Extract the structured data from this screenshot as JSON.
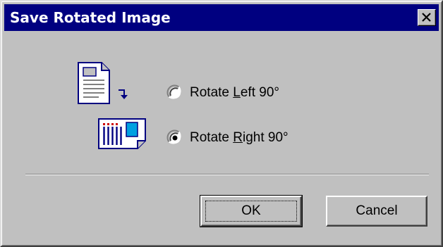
{
  "window": {
    "title": "Save Rotated Image",
    "close_icon": "close-icon"
  },
  "icons": {
    "original": "document-icon",
    "arrow": "rotate-arrow-icon",
    "rotated": "rotated-document-icon"
  },
  "options": [
    {
      "pre": "Rotate ",
      "mnemonic": "L",
      "post": "eft 90°",
      "selected": false
    },
    {
      "pre": "Rotate ",
      "mnemonic": "R",
      "post": "ight 90°",
      "selected": true
    }
  ],
  "buttons": {
    "ok": "OK",
    "cancel": "Cancel"
  },
  "colors": {
    "titlebar": "#000080",
    "face": "#c0c0c0"
  }
}
